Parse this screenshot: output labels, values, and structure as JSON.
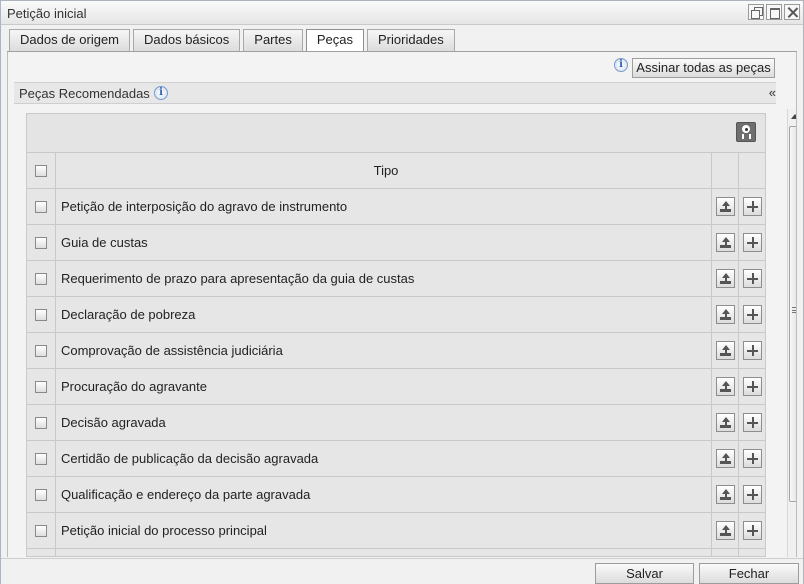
{
  "window": {
    "title": "Petição inicial"
  },
  "tabs": [
    {
      "label": "Dados de origem"
    },
    {
      "label": "Dados básicos"
    },
    {
      "label": "Partes"
    },
    {
      "label": "Peças",
      "active": true
    },
    {
      "label": "Prioridades"
    }
  ],
  "toolbar": {
    "assinar_label": "Assinar todas as peças"
  },
  "section": {
    "title": "Peças Recomendadas",
    "collapse_symbol": "«"
  },
  "grid": {
    "column_header": "Tipo",
    "rows": [
      {
        "tipo": "Petição de interposição do agravo de instrumento"
      },
      {
        "tipo": "Guia de custas"
      },
      {
        "tipo": "Requerimento de prazo para apresentação da guia de custas"
      },
      {
        "tipo": "Declaração de pobreza"
      },
      {
        "tipo": "Comprovação de assistência judiciária"
      },
      {
        "tipo": "Procuração do agravante"
      },
      {
        "tipo": "Decisão agravada"
      },
      {
        "tipo": "Certidão de publicação da decisão agravada"
      },
      {
        "tipo": "Qualificação e endereço da parte agravada"
      },
      {
        "tipo": "Petição inicial do processo principal"
      },
      {
        "tipo": ""
      }
    ]
  },
  "footer": {
    "save_label": "Salvar",
    "close_label": "Fechar"
  },
  "icons": {
    "info": "info-icon",
    "upload": "upload-icon",
    "add": "plus-icon",
    "toolbar": "certificate-icon"
  }
}
